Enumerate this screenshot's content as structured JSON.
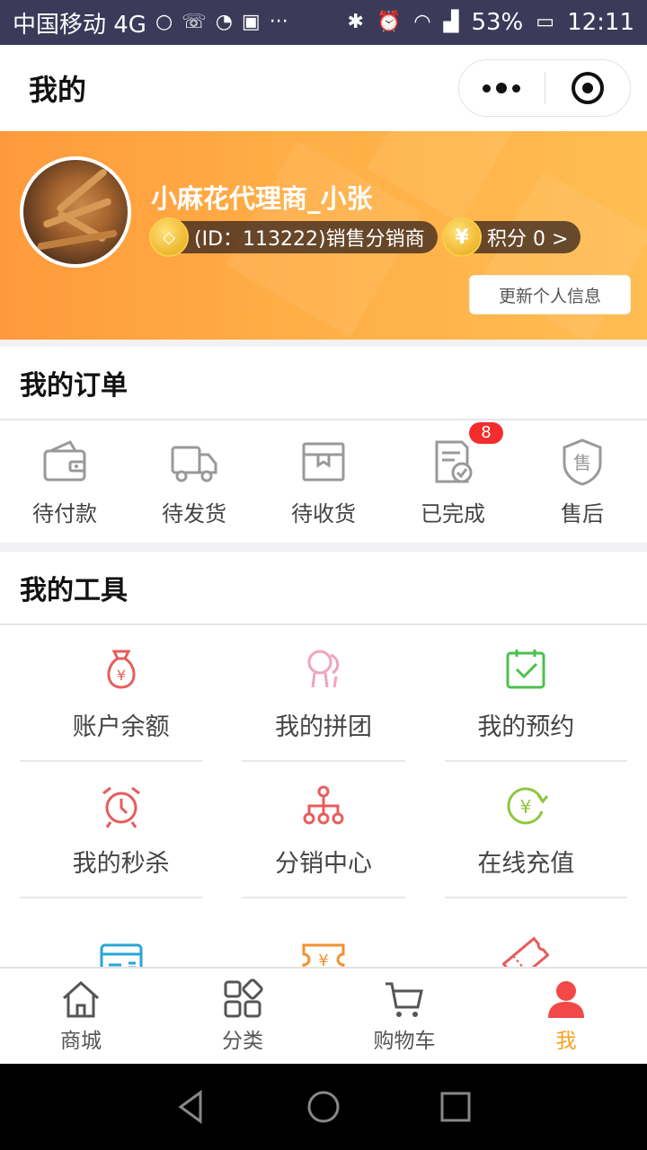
{
  "status_bar": {
    "carrier": "中国移动 4G",
    "battery": "53%",
    "time": "12:11"
  },
  "header": {
    "title": "我的"
  },
  "profile": {
    "name": "小麻花代理商_小张",
    "id_label": "(ID：113222)销售分销商",
    "points_label": "积分 0 >",
    "update_button": "更新个人信息"
  },
  "orders": {
    "title": "我的订单",
    "items": [
      {
        "label": "待付款",
        "icon": "wallet-icon"
      },
      {
        "label": "待发货",
        "icon": "truck-icon"
      },
      {
        "label": "待收货",
        "icon": "package-icon"
      },
      {
        "label": "已完成",
        "icon": "completed-doc-icon",
        "badge": "8"
      },
      {
        "label": "售后",
        "icon": "after-sale-shield-icon"
      }
    ]
  },
  "tools": {
    "title": "我的工具",
    "items": [
      {
        "label": "账户余额",
        "icon": "money-bag-icon"
      },
      {
        "label": "我的拼团",
        "icon": "group-icon"
      },
      {
        "label": "我的预约",
        "icon": "calendar-check-icon"
      },
      {
        "label": "我的秒杀",
        "icon": "alarm-clock-icon"
      },
      {
        "label": "分销中心",
        "icon": "network-icon"
      },
      {
        "label": "在线充值",
        "icon": "recharge-icon"
      },
      {
        "label": "",
        "icon": "card-icon"
      },
      {
        "label": "",
        "icon": "coupon-icon"
      },
      {
        "label": "",
        "icon": "ticket-icon"
      }
    ]
  },
  "tabbar": {
    "items": [
      {
        "label": "商城",
        "icon": "home-icon"
      },
      {
        "label": "分类",
        "icon": "category-icon"
      },
      {
        "label": "购物车",
        "icon": "cart-icon"
      },
      {
        "label": "我",
        "icon": "user-icon",
        "active": true
      }
    ]
  },
  "colors": {
    "banner_start": "#ff9a3c",
    "banner_end": "#ffbd52",
    "active_tab": "#f7a21b",
    "badge": "#f32d2d"
  }
}
